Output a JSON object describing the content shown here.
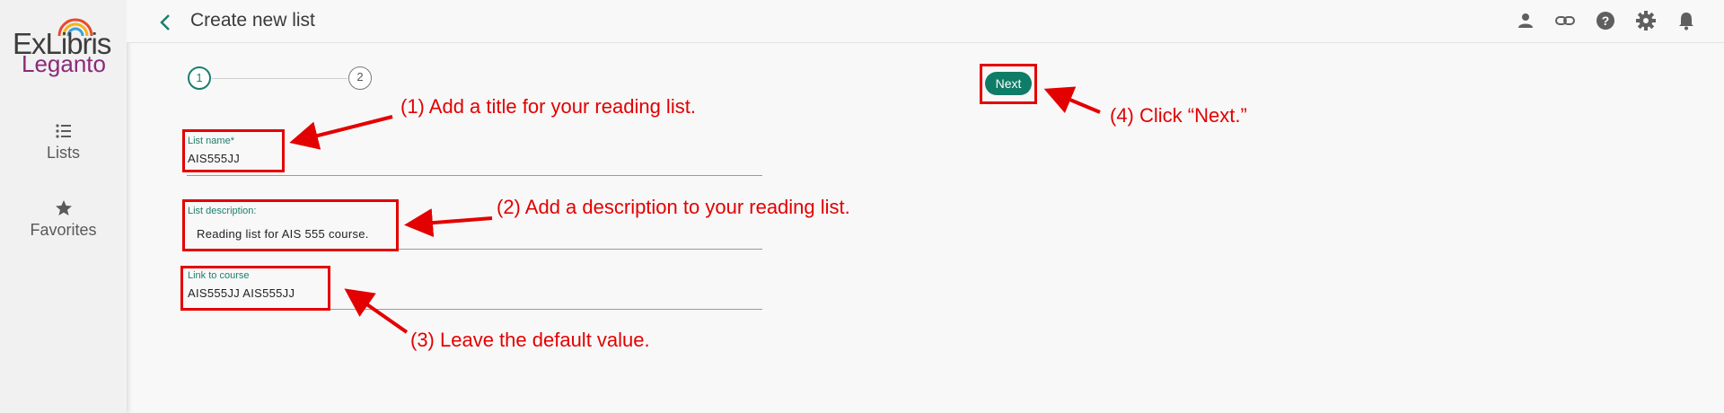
{
  "app": {
    "brand_top": "ExLibris",
    "brand_bottom": "Leganto"
  },
  "sidebar": {
    "items": [
      {
        "label": "Lists",
        "icon": "list-icon"
      },
      {
        "label": "Favorites",
        "icon": "star-icon"
      }
    ]
  },
  "header": {
    "title": "Create new list",
    "icons": [
      "user-icon",
      "link-icon",
      "help-icon",
      "gear-icon",
      "bell-icon"
    ]
  },
  "stepper": {
    "steps": [
      "1",
      "2"
    ],
    "active_step": 1
  },
  "form": {
    "list_name": {
      "label": "List name*",
      "value": "AIS555JJ"
    },
    "list_description": {
      "label": "List description:",
      "value": "Reading list for AIS 555 course."
    },
    "link_to_course": {
      "label": "Link to course",
      "value": "AIS555JJ AIS555JJ"
    }
  },
  "actions": {
    "next_label": "Next"
  },
  "annotations": {
    "step1": "(1) Add a title for your reading list.",
    "step2": "(2) Add a description to your reading list.",
    "step3": "(3) Leave the default value.",
    "step4": "(4) Click “Next.”"
  },
  "colors": {
    "accent": "#0f7c68",
    "annotation": "#e30000",
    "brand_purple": "#8a2a7a"
  }
}
